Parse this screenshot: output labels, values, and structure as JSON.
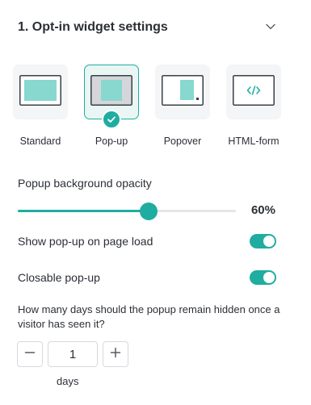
{
  "header": {
    "title": "1. Opt-in widget settings",
    "chevron_icon": "chevron-down-icon"
  },
  "widget_types": [
    {
      "label": "Standard",
      "icon": "standard-layout-icon",
      "selected": false
    },
    {
      "label": "Pop-up",
      "icon": "popup-layout-icon",
      "selected": true
    },
    {
      "label": "Popover",
      "icon": "popover-layout-icon",
      "selected": false
    },
    {
      "label": "HTML-form",
      "icon": "code-icon",
      "selected": false
    }
  ],
  "opacity": {
    "label": "Popup background opacity",
    "value": 60,
    "value_text": "60%"
  },
  "toggles": {
    "show_on_load": {
      "label": "Show pop-up on page load",
      "on": true
    },
    "closable": {
      "label": "Closable pop-up",
      "on": true
    }
  },
  "days": {
    "question": "How many days should the popup remain hidden once a visitor has seen it?",
    "value": "1",
    "unit": "days"
  },
  "colors": {
    "accent": "#1eada0",
    "accent_light": "#88d8cf",
    "text": "#2b2f36",
    "card_bg": "#f4f5f7"
  }
}
